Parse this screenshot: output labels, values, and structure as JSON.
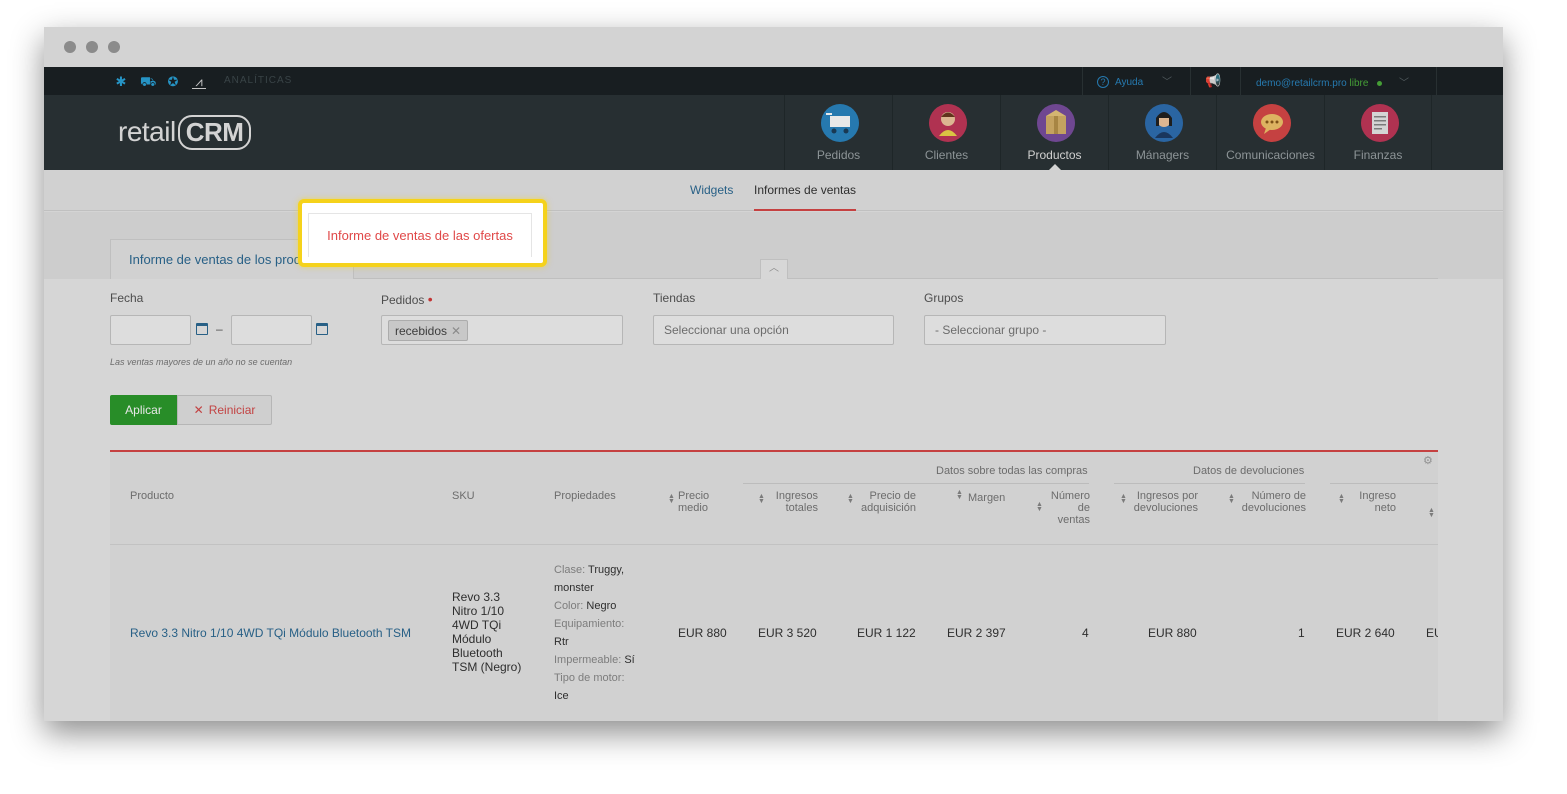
{
  "topbar": {
    "section_label": "ANALÍTICAS",
    "help_label": "Ayuda",
    "user_email": "demo@retailcrm.pro",
    "user_status": "libre"
  },
  "logo": {
    "prefix": "retail",
    "suffix": "CRM"
  },
  "nav": {
    "items": [
      {
        "label": "Pedidos",
        "icon": "shopping-cart-icon",
        "color": "#2a86c1"
      },
      {
        "label": "Clientes",
        "icon": "customer-avatar-icon",
        "color": "#c2375a"
      },
      {
        "label": "Productos",
        "icon": "box-icon",
        "color": "#7b4fa0"
      },
      {
        "label": "Mánagers",
        "icon": "manager-avatar-icon",
        "color": "#2f6fb2"
      },
      {
        "label": "Comunicaciones",
        "icon": "chat-bubble-icon",
        "color": "#d94848"
      },
      {
        "label": "Finanzas",
        "icon": "receipt-icon",
        "color": "#c2375a"
      }
    ],
    "active": "Productos"
  },
  "subnav": {
    "widgets": "Widgets",
    "sales_reports": "Informes de ventas"
  },
  "tabs": {
    "products_report": "Informe de ventas de los productos",
    "offers_report": "Informe de ventas de las ofertas"
  },
  "filters": {
    "date_label": "Fecha",
    "date_separator": "–",
    "orders_label": "Pedidos",
    "orders_chip": "recebidos",
    "stores_label": "Tiendas",
    "stores_placeholder": "Seleccionar una opción",
    "groups_label": "Grupos",
    "groups_placeholder": "- Seleccionar grupo -",
    "hint": "Las ventas mayores de un año no se cuentan",
    "apply": "Aplicar",
    "reset": "Reiniciar"
  },
  "table": {
    "group_all": "Datos sobre todas las compras",
    "group_returns": "Datos de devoluciones",
    "columns": {
      "product": "Producto",
      "sku": "SKU",
      "properties": "Propiedades",
      "avg_price_1": "Precio",
      "avg_price_2": "medio",
      "total_income_1": "Ingresos",
      "total_income_2": "totales",
      "acq_price_1": "Precio de",
      "acq_price_2": "adquisición",
      "margin": "Margen",
      "sales_count_1": "Número",
      "sales_count_2": "de",
      "sales_count_3": "ventas",
      "return_income_1": "Ingresos por",
      "return_income_2": "devoluciones",
      "return_count_1": "Número de",
      "return_count_2": "devoluciones",
      "net_income_1": "Ingreso",
      "net_income_2": "neto"
    },
    "row": {
      "product": "Revo 3.3 Nitro 1/10 4WD TQi Módulo Bluetooth TSM",
      "sku_lines": [
        "Revo 3.3",
        "Nitro 1/10",
        "4WD TQi",
        "Módulo",
        "Bluetooth",
        "TSM (Negro)"
      ],
      "props": {
        "clase_k": "Clase:",
        "clase_v1": "Truggy,",
        "clase_v2": "monster",
        "color_k": "Color:",
        "color_v": "Negro",
        "equip_k": "Equipamiento:",
        "equip_v": "Rtr",
        "imp_k": "Impermeable:",
        "imp_v": "Sí",
        "motor_k": "Tipo de motor:",
        "motor_v": "Ice"
      },
      "avg_price": "EUR 880",
      "total_income": "EUR 3 520",
      "acq_price": "EUR 1 122",
      "margin": "EUR 2 397",
      "sales_count": "4",
      "return_income": "EUR 880",
      "return_count": "1",
      "net_income": "EUR 2 640",
      "cut_cell": "EU"
    }
  }
}
